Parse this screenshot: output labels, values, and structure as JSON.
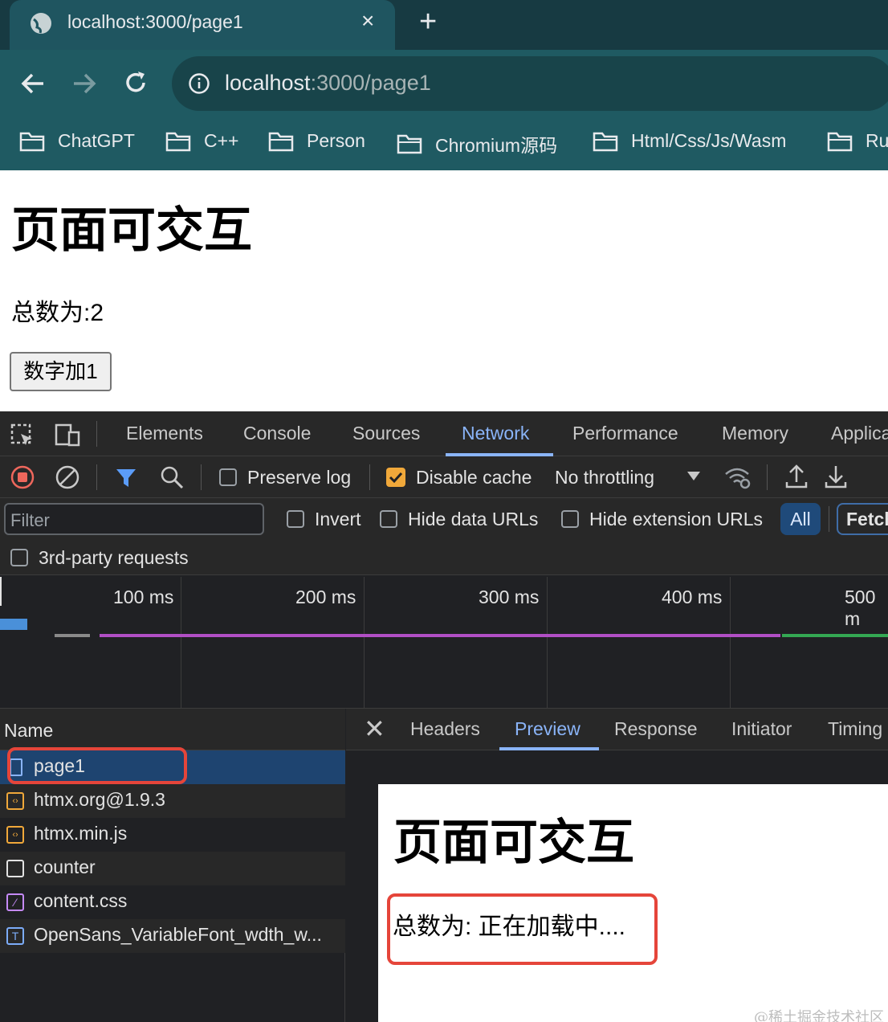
{
  "browser": {
    "tab_title": "localhost:3000/page1",
    "url": "localhost:3000/page1",
    "url_host": "localhost",
    "url_rest": ":3000/page1",
    "bookmarks": [
      "ChatGPT",
      "C++",
      "Person",
      "Chromium源码",
      "Html/Css/Js/Wasm",
      "Ru"
    ]
  },
  "page": {
    "heading": "页面可交互",
    "count_text": "总数为:2",
    "button_label": "数字加1"
  },
  "devtools": {
    "tabs": [
      "Elements",
      "Console",
      "Sources",
      "Network",
      "Performance",
      "Memory",
      "Applica"
    ],
    "active_tab": "Network",
    "toolbar": {
      "preserve_log": "Preserve log",
      "disable_cache": "Disable cache",
      "throttling": "No throttling"
    },
    "filter": {
      "placeholder": "Filter",
      "invert": "Invert",
      "hide_data_urls": "Hide data URLs",
      "hide_extension_urls": "Hide extension URLs",
      "all": "All",
      "fetch": "Fetch",
      "third_party": "3rd-party requests"
    },
    "timeline_labels": [
      "100 ms",
      "200 ms",
      "300 ms",
      "400 ms",
      "500 m"
    ],
    "name_header": "Name",
    "requests": [
      {
        "name": "page1",
        "icon": "document-icon"
      },
      {
        "name": "htmx.org@1.9.3",
        "icon": "script-icon"
      },
      {
        "name": "htmx.min.js",
        "icon": "script-icon"
      },
      {
        "name": "counter",
        "icon": "blank-icon"
      },
      {
        "name": "content.css",
        "icon": "stylesheet-icon"
      },
      {
        "name": "OpenSans_VariableFont_wdth_w...",
        "icon": "font-icon"
      }
    ],
    "detail_tabs": [
      "Headers",
      "Preview",
      "Response",
      "Initiator",
      "Timing"
    ],
    "active_detail_tab": "Preview",
    "preview": {
      "heading": "页面可交互",
      "count_text": "总数为: 正在加载中...."
    }
  },
  "watermark": "@稀土掘金技术社区"
}
